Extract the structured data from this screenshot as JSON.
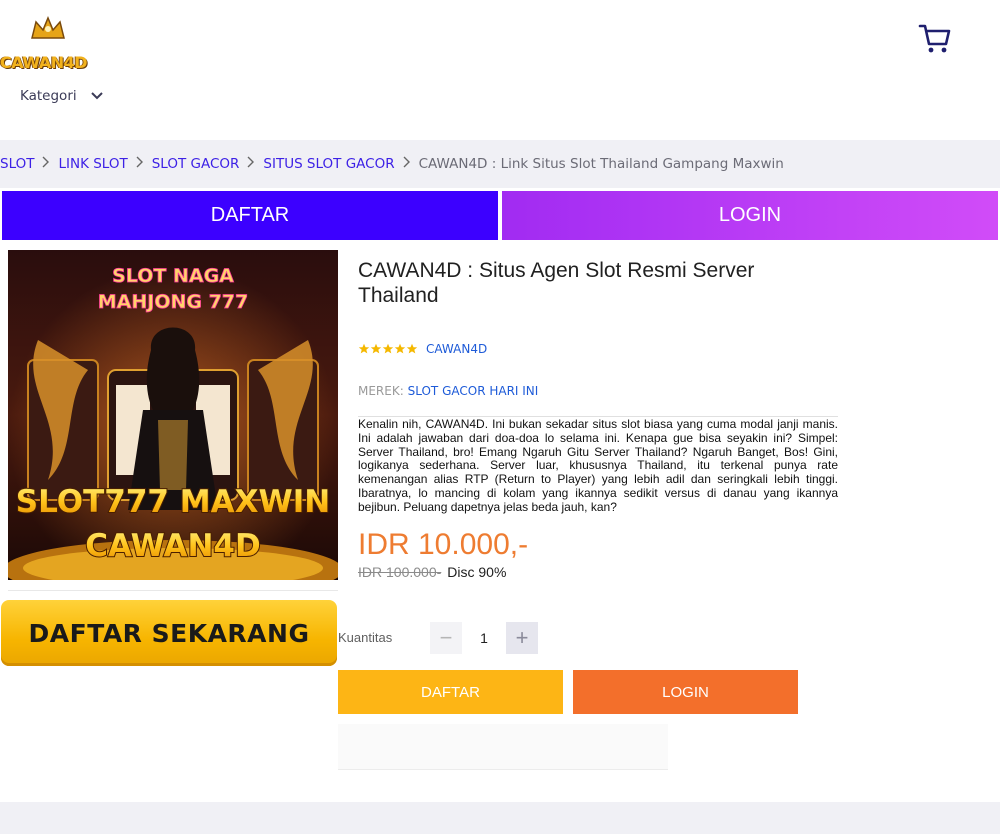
{
  "header": {
    "logo_text": "CAWAN4D",
    "cart_icon": "shopping-cart-icon",
    "kategori_label": "Kategori"
  },
  "breadcrumb": {
    "items": [
      "SLOT",
      "LINK SLOT",
      "SLOT GACOR",
      "SITUS SLOT GACOR"
    ],
    "current": "CAWAN4D : Link Situs Slot Thailand Gampang Maxwin"
  },
  "top_buttons": {
    "daftar": "DAFTAR",
    "login": "LOGIN"
  },
  "product_image": {
    "top_text_line1": "SLOT NAGA",
    "top_text_line2": "MAHJONG 777",
    "bottom_text_line1": "SLOT777 MAXWIN",
    "bottom_text_line2": "CAWAN4D"
  },
  "banner": {
    "label": "DAFTAR SEKARANG"
  },
  "product": {
    "title": "CAWAN4D : Situs Agen Slot Resmi Server Thailand",
    "rating_stars": 5,
    "seller": "CAWAN4D",
    "merek_label": "MEREK:",
    "merek_value": "SLOT GACOR HARI INI",
    "description": "Kenalin nih, CAWAN4D. Ini bukan sekadar situs slot biasa yang cuma modal janji manis. Ini adalah jawaban dari doa-doa lo selama ini. Kenapa gue bisa seyakin ini? Simpel: Server Thailand, bro! Emang Ngaruh Gitu Server Thailand? Ngaruh Banget, Bos! Gini, logikanya sederhana. Server luar, khususnya Thailand, itu terkenal punya rate kemenangan alias RTP (Return to Player) yang lebih adil dan seringkali lebih tinggi. Ibaratnya, lo mancing di kolam yang ikannya sedikit versus di danau yang ikannya bejibun. Peluang dapetnya jelas beda jauh, kan?",
    "price": "IDR 10.000,-",
    "old_price": "IDR 100.000-",
    "discount": "Disc 90%",
    "quantity_label": "Kuantitas",
    "quantity": "1",
    "minus_symbol": "−",
    "plus_symbol": "+",
    "daftar_button": "DAFTAR",
    "login_button": "LOGIN"
  },
  "colors": {
    "top_daftar": "#3c00ff",
    "top_login": "#c03ef6",
    "price": "#ee7c31",
    "act_daftar": "#fdb515",
    "act_login": "#f36f2b",
    "link": "#3d21e6"
  }
}
